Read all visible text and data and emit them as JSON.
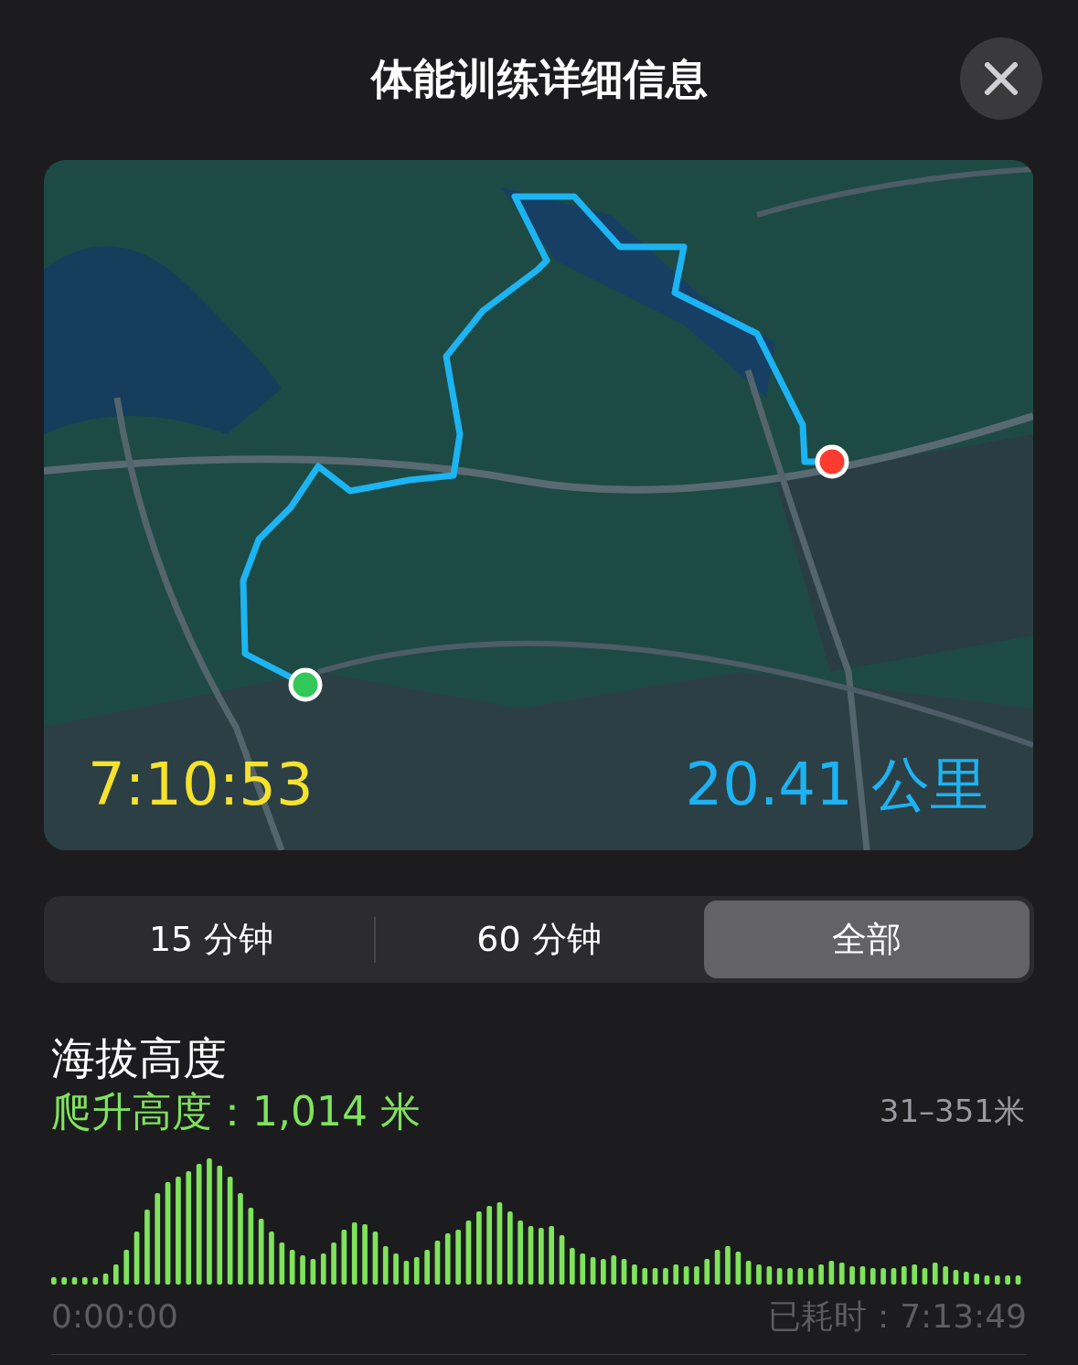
{
  "header": {
    "title": "体能训练详细信息"
  },
  "map": {
    "kind": "picture",
    "duration": "7:10:53",
    "distance": "20.41 公里"
  },
  "range_tabs": [
    {
      "label": "15 分钟",
      "selected": false
    },
    {
      "label": "60 分钟",
      "selected": false
    },
    {
      "label": "全部",
      "selected": true
    }
  ],
  "elevation": {
    "title": "海拔高度",
    "climb": "爬升高度：1,014 米",
    "range": "31–351米",
    "start_time": "0:00:00",
    "elapsed": "已耗时：7:13:49"
  }
}
